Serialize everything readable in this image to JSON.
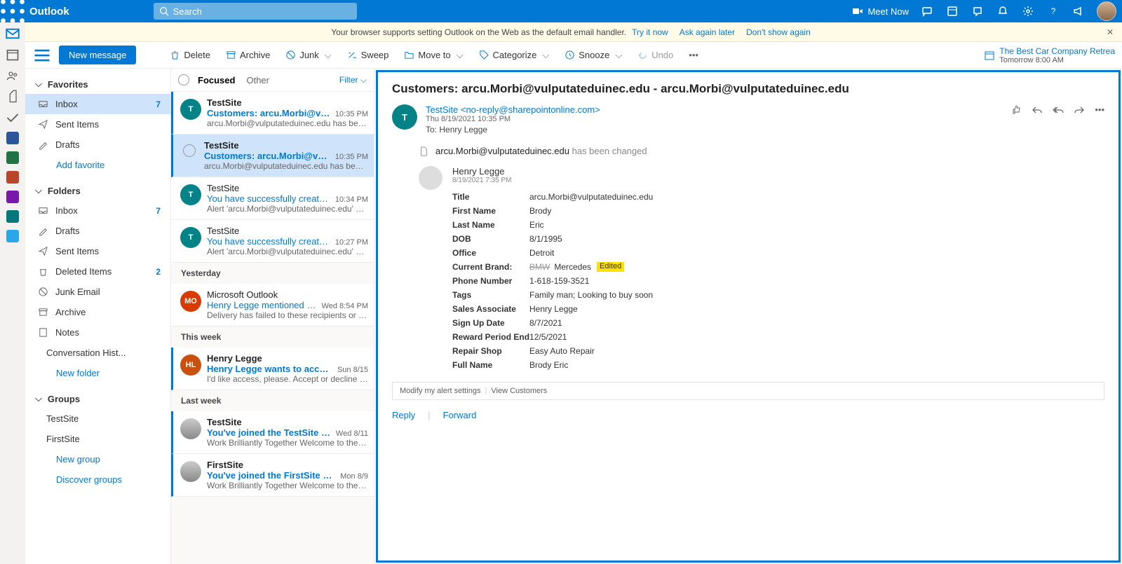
{
  "brand": "Outlook",
  "search": {
    "placeholder": "Search"
  },
  "topRight": {
    "meetNow": "Meet Now"
  },
  "banner": {
    "text": "Your browser supports setting Outlook on the Web as the default email handler.",
    "tryNow": "Try it now",
    "askLater": "Ask again later",
    "dontShow": "Don't show again"
  },
  "cmd": {
    "newMessage": "New message",
    "delete": "Delete",
    "archive": "Archive",
    "junk": "Junk",
    "sweep": "Sweep",
    "moveTo": "Move to",
    "categorize": "Categorize",
    "snooze": "Snooze",
    "undo": "Undo"
  },
  "calWidget": {
    "title": "The Best Car Company Retrea",
    "sub": "Tomorrow 8:00 AM"
  },
  "nav": {
    "favorites": "Favorites",
    "inbox": "Inbox",
    "inboxCount": "7",
    "sent": "Sent Items",
    "drafts": "Drafts",
    "addFav": "Add favorite",
    "folders": "Folders",
    "inbox2": "Inbox",
    "inbox2Count": "7",
    "drafts2": "Drafts",
    "sent2": "Sent Items",
    "deleted": "Deleted Items",
    "deletedCount": "2",
    "junk": "Junk Email",
    "archive": "Archive",
    "notes": "Notes",
    "convo": "Conversation Hist...",
    "newFolder": "New folder",
    "groups": "Groups",
    "g1": "TestSite",
    "g2": "FirstSite",
    "newGroup": "New group",
    "discover": "Discover groups"
  },
  "list": {
    "focused": "Focused",
    "other": "Other",
    "filter": "Filter",
    "items": [
      {
        "from": "TestSite",
        "subj": "Customers: arcu.Morbi@vulputa...",
        "time": "10:35 PM",
        "prev": "arcu.Morbi@vulputateduinec.edu has been c...",
        "unread": true,
        "av": "T"
      },
      {
        "from": "TestSite",
        "subj": "Customers: arcu.Morbi@vulputa...",
        "time": "10:35 PM",
        "prev": "arcu.Morbi@vulputateduinec.edu has been c...",
        "unread": true,
        "sel": true,
        "chk": true
      },
      {
        "from": "TestSite",
        "subj": "You have successfully created an ...",
        "time": "10:34 PM",
        "prev": "Alert 'arcu.Morbi@vulputateduinec.edu' has ...",
        "av": "T"
      },
      {
        "from": "TestSite",
        "subj": "You have successfully created an ...",
        "time": "10:27 PM",
        "prev": "Alert 'arcu.Morbi@vulputateduinec.edu' has ...",
        "av": "T"
      }
    ],
    "yesterday": "Yesterday",
    "yItems": [
      {
        "from": "Microsoft Outlook",
        "subj": "Henry Legge mentioned you ...",
        "time": "Wed 8:54 PM",
        "prev": "Delivery has failed to these recipients or gro...",
        "av": "MO",
        "avBg": "#d83b01"
      }
    ],
    "thisWeek": "This week",
    "wItems": [
      {
        "from": "Henry Legge",
        "subj": "Henry Legge wants to access 'Tes...",
        "time": "Sun 8/15",
        "prev": "I'd like access, please. Accept or decline this ...",
        "unread": true,
        "av": "HL",
        "avBg": "#ca5010"
      }
    ],
    "lastWeek": "Last week",
    "lItems": [
      {
        "from": "TestSite",
        "subj": "You've joined the TestSite group",
        "time": "Wed 8/11",
        "prev": "Work Brilliantly Together Welcome to the Te...",
        "unread": true,
        "avImg": true
      },
      {
        "from": "FirstSite",
        "subj": "You've joined the FirstSite group",
        "time": "Mon 8/9",
        "prev": "Work Brilliantly Together Welcome to the Fir...",
        "unread": true,
        "avImg": true
      }
    ]
  },
  "read": {
    "subject": "Customers: arcu.Morbi@vulputateduinec.edu - arcu.Morbi@vulputateduinec.edu",
    "senderDisplay": "TestSite <no-reply@sharepointonline.com>",
    "date": "Thu 8/19/2021 10:35 PM",
    "toLabel": "To:",
    "to": "Henry Legge",
    "changedItem": "arcu.Morbi@vulputateduinec.edu",
    "changedSuffix": "has been changed",
    "profileName": "Henry Legge",
    "profileTs": "8/19/2021 7:35 PM",
    "fields": {
      "Title": "arcu.Morbi@vulputateduinec.edu",
      "FirstName": "Brody",
      "LastName": "Eric",
      "DOB": "8/1/1995",
      "Office": "Detroit",
      "BrandLabel": "Current Brand:",
      "BrandOld": "BMW",
      "BrandNew": "Mercedes",
      "Edited": "Edited",
      "Phone": "1-618-159-3521",
      "Tags": "Family man; Looking to buy soon",
      "Sales": "Henry Legge",
      "SignUp": "8/7/2021",
      "Reward": "12/5/2021",
      "Repair": "Easy Auto Repair",
      "FullName": "Brody Eric"
    },
    "labels": {
      "Title": "Title",
      "FirstName": "First Name",
      "LastName": "Last Name",
      "DOB": "DOB",
      "Office": "Office",
      "Phone": "Phone Number",
      "Tags": "Tags",
      "Sales": "Sales Associate",
      "SignUp": "Sign Up Date",
      "Reward": "Reward Period End",
      "Repair": "Repair Shop",
      "FullName": "Full Name"
    },
    "alertModify": "Modify my alert settings",
    "alertView": "View Customers",
    "reply": "Reply",
    "forward": "Forward"
  }
}
